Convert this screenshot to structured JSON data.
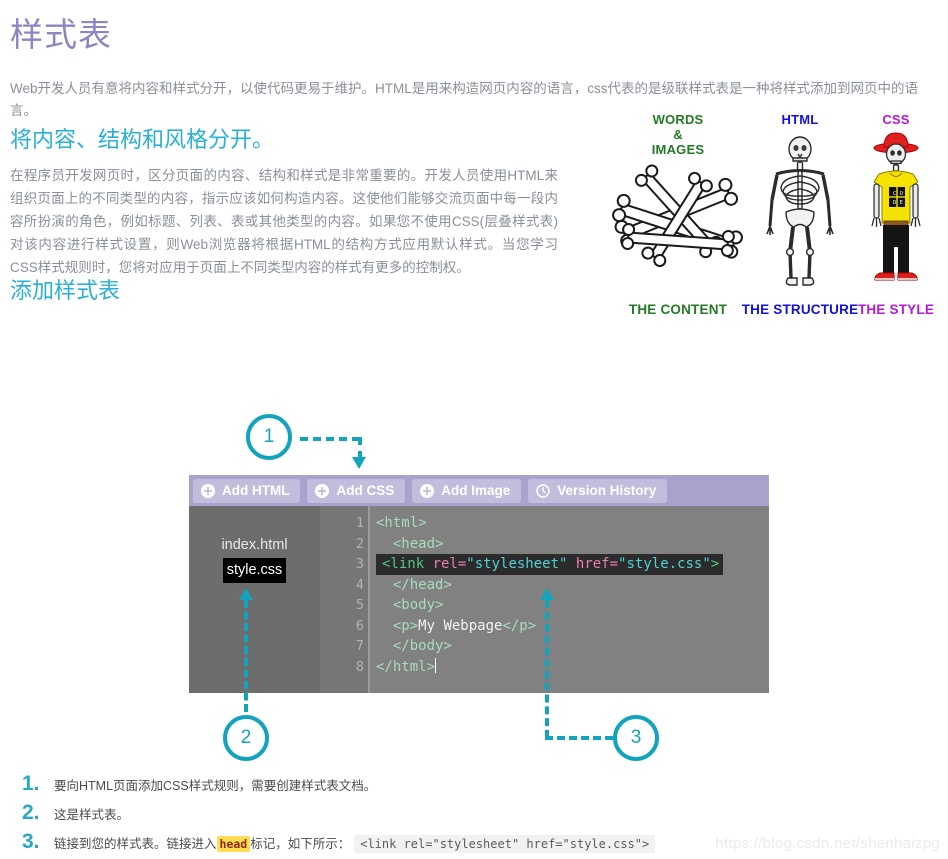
{
  "page": {
    "title": "样式表",
    "intro": "Web开发人员有意将内容和样式分开，以使代码更易于维护。HTML是用来构造网页内容的语言，css代表的是级联样式表是一种将样式添加到网页中的语言。",
    "section_separate_heading": "将内容、结构和风格分开。",
    "section_separate_body": "在程序员开发网页时，区分页面的内容、结构和样式是非常重要的。开发人员使用HTML来组织页面上的不同类型的内容，指示应该如何构造内容。这使他们能够交流页面中每一段内容所扮演的角色，例如标题、列表、表或其他类型的内容。如果您不使用CSS(层叠样式表)对该内容进行样式设置，则Web浏览器将根据HTML的结构方式应用默认样式。当您学习CSS样式规则时，您将对应用于页面上不同类型内容的样式有更多的控制权。",
    "section_add_heading": "添加样式表",
    "watermark": "https://blog.csdn.net/shenhaizpg"
  },
  "illustration": {
    "columns": [
      {
        "top_label_lines": [
          "WORDS",
          "&",
          "IMAGES"
        ],
        "bottom_label": "THE CONTENT",
        "color": "#247a25",
        "art": "pile-of-bones"
      },
      {
        "top_label_lines": [
          "HTML"
        ],
        "bottom_label": "THE STRUCTURE",
        "color": "#1111dd",
        "art": "skeleton"
      },
      {
        "top_label_lines": [
          "CSS"
        ],
        "bottom_label": "THE STYLE",
        "color": "#b718d8",
        "art": "dressed-skeleton",
        "shirt_logo": [
          "C",
          "O",
          "D",
          "E"
        ]
      }
    ]
  },
  "editor": {
    "toolbar": [
      {
        "label": "Add HTML",
        "icon": "plus-circle-icon"
      },
      {
        "label": "Add CSS",
        "icon": "plus-circle-icon"
      },
      {
        "label": "Add Image",
        "icon": "plus-circle-icon"
      },
      {
        "label": "Version History",
        "icon": "clock-icon"
      }
    ],
    "files": [
      {
        "name": "index.html",
        "active": false
      },
      {
        "name": "style.css",
        "active": true
      }
    ],
    "line_numbers": [
      "1",
      "2",
      "3",
      "4",
      "5",
      "6",
      "7",
      "8"
    ],
    "folds": [
      true,
      true,
      false,
      false,
      true,
      false,
      false,
      false
    ],
    "code": [
      {
        "n": "1",
        "indent": 0,
        "highlight": false,
        "parts": [
          {
            "t": "tag",
            "v": "<html>"
          }
        ]
      },
      {
        "n": "2",
        "indent": 1,
        "highlight": false,
        "parts": [
          {
            "t": "tag",
            "v": "<head>"
          }
        ]
      },
      {
        "n": "3",
        "indent": 1,
        "highlight": true,
        "parts": [
          {
            "t": "tagb",
            "v": "<link "
          },
          {
            "t": "attr",
            "v": "rel="
          },
          {
            "t": "str",
            "v": "\"stylesheet\""
          },
          {
            "t": "plain",
            "v": " "
          },
          {
            "t": "attr",
            "v": "href="
          },
          {
            "t": "str",
            "v": "\"style.css\""
          },
          {
            "t": "tagb",
            "v": ">"
          }
        ]
      },
      {
        "n": "4",
        "indent": 1,
        "highlight": false,
        "parts": [
          {
            "t": "tag",
            "v": "</head>"
          }
        ]
      },
      {
        "n": "5",
        "indent": 1,
        "highlight": false,
        "parts": [
          {
            "t": "tag",
            "v": "<body>"
          }
        ]
      },
      {
        "n": "6",
        "indent": 1,
        "highlight": false,
        "parts": [
          {
            "t": "tag",
            "v": "<p>"
          },
          {
            "t": "txt",
            "v": "My Webpage"
          },
          {
            "t": "tag",
            "v": "</p>"
          }
        ]
      },
      {
        "n": "7",
        "indent": 1,
        "highlight": false,
        "parts": [
          {
            "t": "tag",
            "v": "</body>"
          }
        ]
      },
      {
        "n": "8",
        "indent": 0,
        "highlight": false,
        "parts": [
          {
            "t": "tag",
            "v": "</html>"
          },
          {
            "t": "caret",
            "v": ""
          }
        ]
      }
    ]
  },
  "callouts": [
    {
      "number": "1",
      "target": "Add CSS"
    },
    {
      "number": "2",
      "target": "style.css"
    },
    {
      "number": "3",
      "target": "link line"
    }
  ],
  "steps": [
    {
      "num": "1.",
      "text": "要向HTML页面添加CSS样式规则，需要创建样式表文档。"
    },
    {
      "num": "2.",
      "text": "这是样式表。"
    },
    {
      "num": "3.",
      "text_before": "链接到您的样式表。链接进入",
      "keyword": "head",
      "text_after": "标记，如下所示：",
      "code": "<link rel=\"stylesheet\" href=\"style.css\">"
    }
  ],
  "colors": {
    "title_purple": "#8c85c4",
    "heading_teal": "#29b0d4",
    "callout_teal": "#13a3bd",
    "toolbar_bg": "#a9a2cd",
    "toolbar_btn": "#c3bddd",
    "editor_bg": "#818181"
  }
}
